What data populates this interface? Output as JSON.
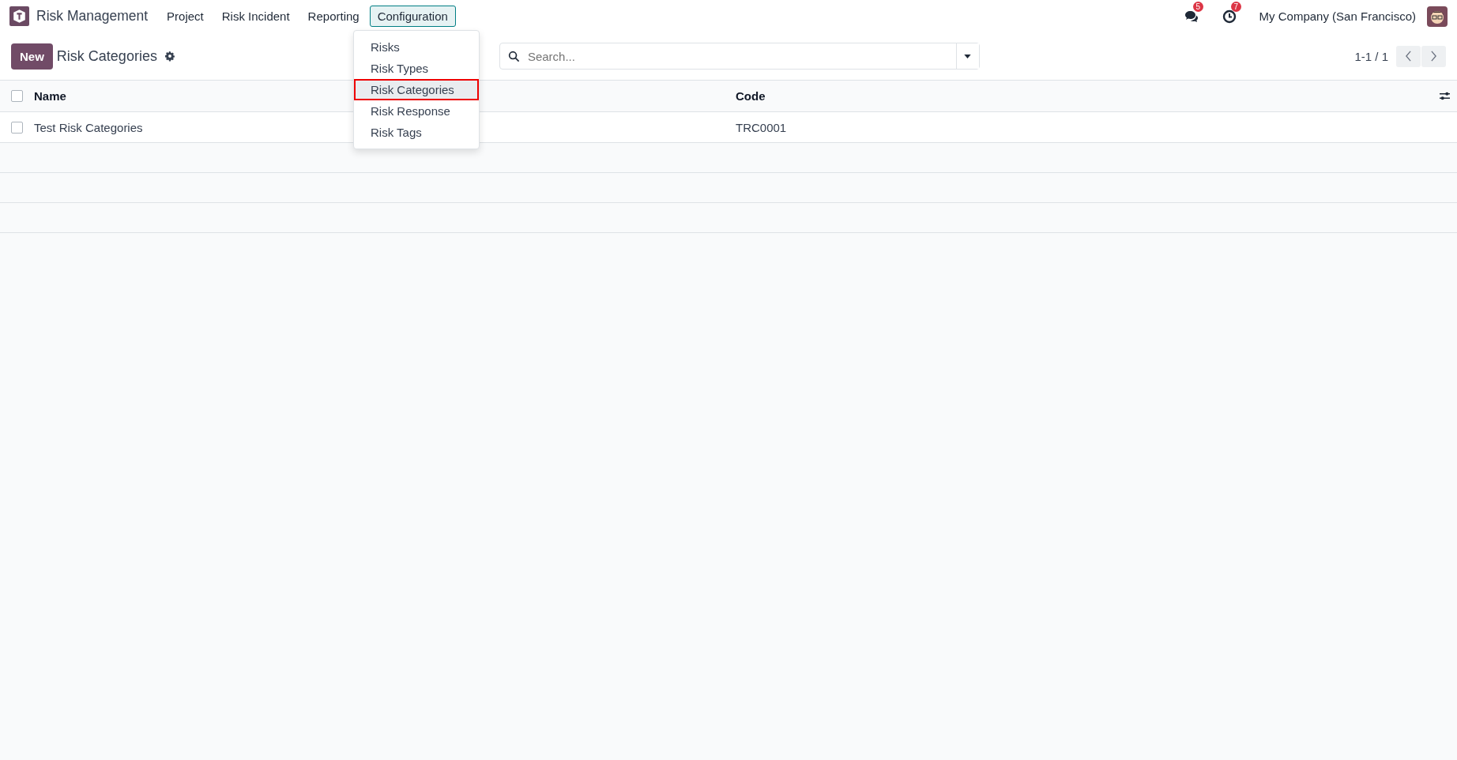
{
  "navbar": {
    "app_name": "Risk Management",
    "menus": [
      {
        "label": "Project",
        "selected": false
      },
      {
        "label": "Risk Incident",
        "selected": false
      },
      {
        "label": "Reporting",
        "selected": false
      },
      {
        "label": "Configuration",
        "selected": true
      }
    ],
    "messages_count": "5",
    "activities_count": "7",
    "company": "My Company (San Francisco)"
  },
  "dropdown": {
    "items": [
      {
        "label": "Risks",
        "selected": false
      },
      {
        "label": "Risk Types",
        "selected": false
      },
      {
        "label": "Risk Categories",
        "selected": true
      },
      {
        "label": "Risk Response",
        "selected": false
      },
      {
        "label": "Risk Tags",
        "selected": false
      }
    ]
  },
  "control_panel": {
    "new_button": "New",
    "title": "Risk Categories",
    "search": {
      "placeholder": "Search..."
    },
    "pager": "1-1 / 1"
  },
  "table": {
    "select_all": {
      "checked": false
    },
    "columns": [
      "Name",
      "Code"
    ],
    "rows": [
      {
        "checked": false,
        "cells": [
          "Test Risk Categories",
          "TRC0001"
        ]
      }
    ]
  }
}
